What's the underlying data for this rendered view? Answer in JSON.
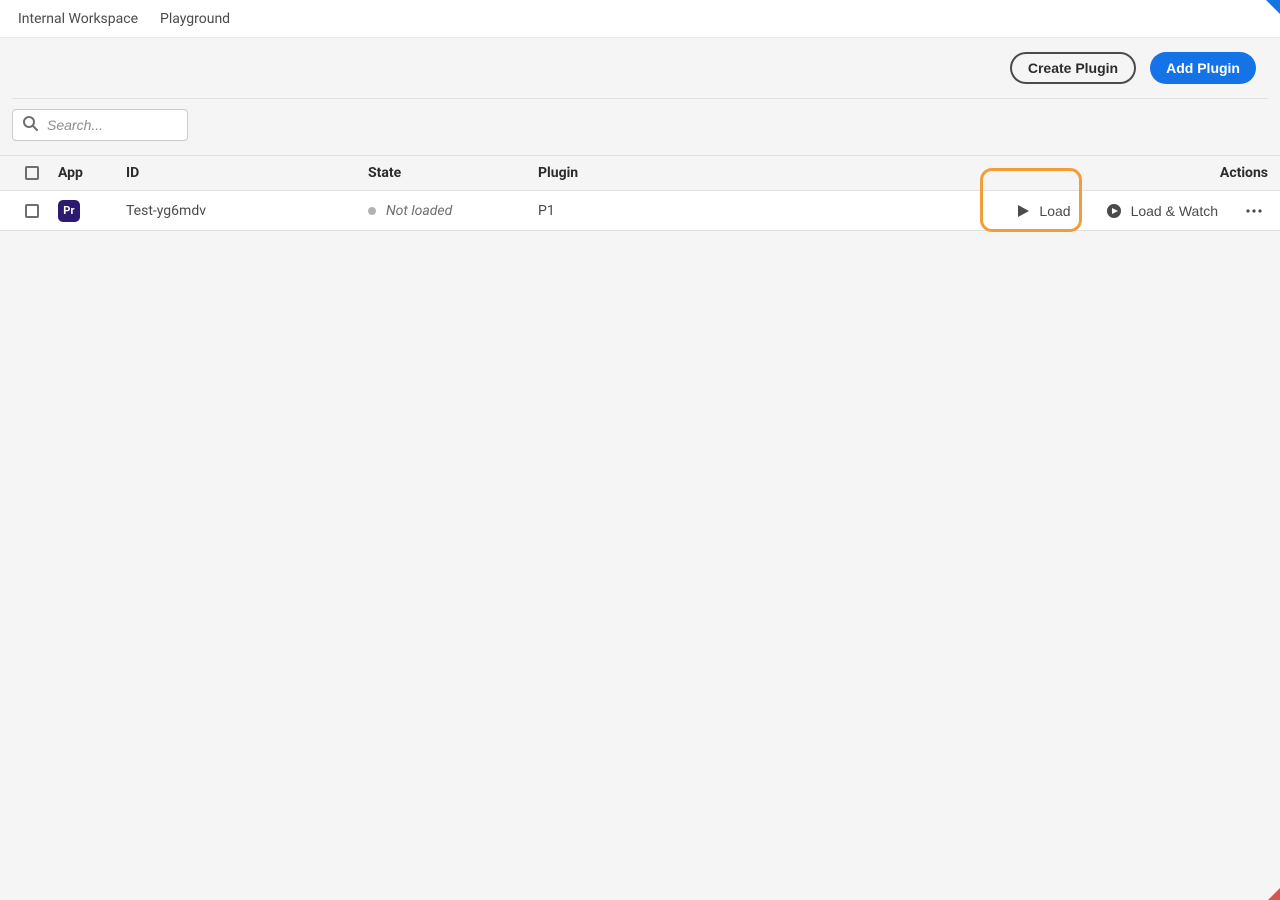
{
  "nav": {
    "workspace": "Internal Workspace",
    "playground": "Playground"
  },
  "toolbar": {
    "create_plugin": "Create Plugin",
    "add_plugin": "Add Plugin"
  },
  "search": {
    "placeholder": "Search..."
  },
  "columns": {
    "app": "App",
    "id": "ID",
    "state": "State",
    "plugin": "Plugin",
    "actions": "Actions"
  },
  "rows": [
    {
      "app_icon_label": "Pr",
      "id": "Test-yg6mdv",
      "state": "Not loaded",
      "plugin": "P1",
      "load_label": "Load",
      "load_watch_label": "Load & Watch"
    }
  ],
  "colors": {
    "primary": "#1473e6",
    "highlight": "#f29d38",
    "app_icon_bg": "#2b1a6e"
  }
}
